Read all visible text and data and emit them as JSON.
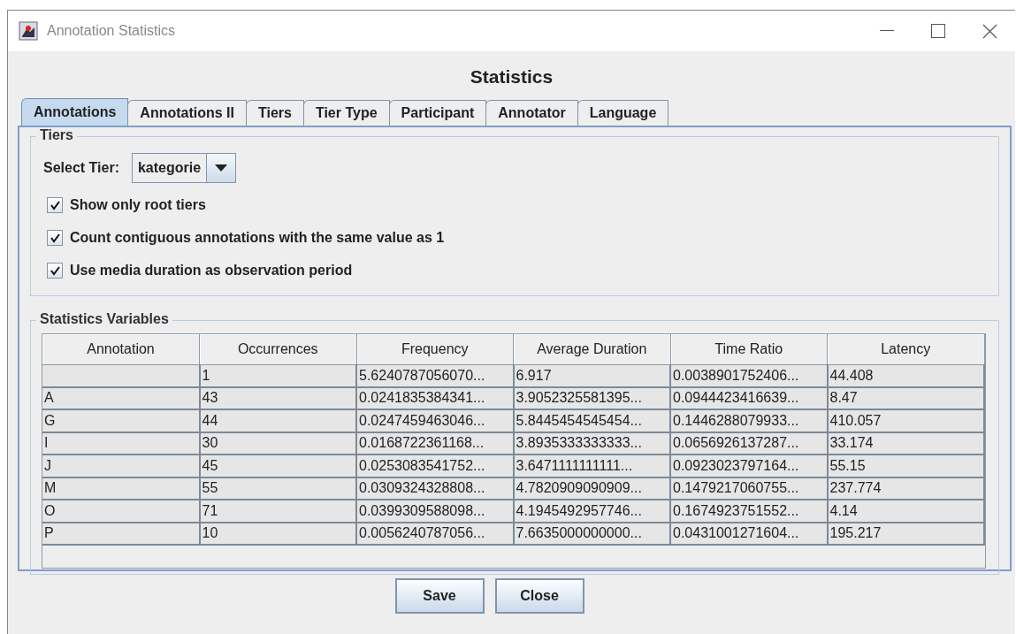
{
  "window": {
    "title": "Annotation Statistics"
  },
  "heading": "Statistics",
  "tabs": [
    {
      "label": "Annotations",
      "selected": true
    },
    {
      "label": "Annotations II",
      "selected": false
    },
    {
      "label": "Tiers",
      "selected": false
    },
    {
      "label": "Tier Type",
      "selected": false
    },
    {
      "label": "Participant",
      "selected": false
    },
    {
      "label": "Annotator",
      "selected": false
    },
    {
      "label": "Language",
      "selected": false
    }
  ],
  "tiers_group": {
    "title": "Tiers",
    "select_label": "Select Tier:",
    "select_value": "kategorie",
    "options": [
      {
        "label": "Show only root tiers",
        "checked": true
      },
      {
        "label": "Count contiguous annotations with the same value as 1",
        "checked": true
      },
      {
        "label": "Use media duration as observation period",
        "checked": true
      }
    ]
  },
  "variables_group": {
    "title": "Statistics Variables",
    "table": {
      "columns": [
        "Annotation",
        "Occurrences",
        "Frequency",
        "Average Duration",
        "Time Ratio",
        "Latency"
      ],
      "rows": [
        {
          "occurrences": "1",
          "frequency": "5.6240787056070...",
          "average_duration": "6.917",
          "time_ratio": "0.0038901752406...",
          "latency": "44.408"
        },
        {
          "annotation": "A",
          "occurrences": "43",
          "frequency": "0.0241835384341...",
          "average_duration": "3.9052325581395...",
          "time_ratio": "0.0944423416639...",
          "latency": "8.47"
        },
        {
          "annotation": "G",
          "occurrences": "44",
          "frequency": "0.0247459463046...",
          "average_duration": "5.8445454545454...",
          "time_ratio": "0.1446288079933...",
          "latency": "410.057"
        },
        {
          "annotation": "I",
          "occurrences": "30",
          "frequency": "0.0168722361168...",
          "average_duration": "3.8935333333333...",
          "time_ratio": "0.0656926137287...",
          "latency": "33.174"
        },
        {
          "annotation": "J",
          "occurrences": "45",
          "frequency": "0.0253083541752...",
          "average_duration": "3.6471111111111...",
          "time_ratio": "0.0923023797164...",
          "latency": "55.15"
        },
        {
          "annotation": "M",
          "occurrences": "55",
          "frequency": "0.0309324328808...",
          "average_duration": "4.7820909090909...",
          "time_ratio": "0.1479217060755...",
          "latency": "237.774"
        },
        {
          "annotation": "O",
          "occurrences": "71",
          "frequency": "0.0399309588098...",
          "average_duration": "4.1945492957746...",
          "time_ratio": "0.1674923751552...",
          "latency": "4.14"
        },
        {
          "annotation": "P",
          "occurrences": "10",
          "frequency": "0.0056240787056...",
          "average_duration": "7.6635000000000...",
          "time_ratio": "0.0431001271604...",
          "latency": "195.217"
        }
      ]
    }
  },
  "buttons": [
    "Save",
    "Close"
  ]
}
